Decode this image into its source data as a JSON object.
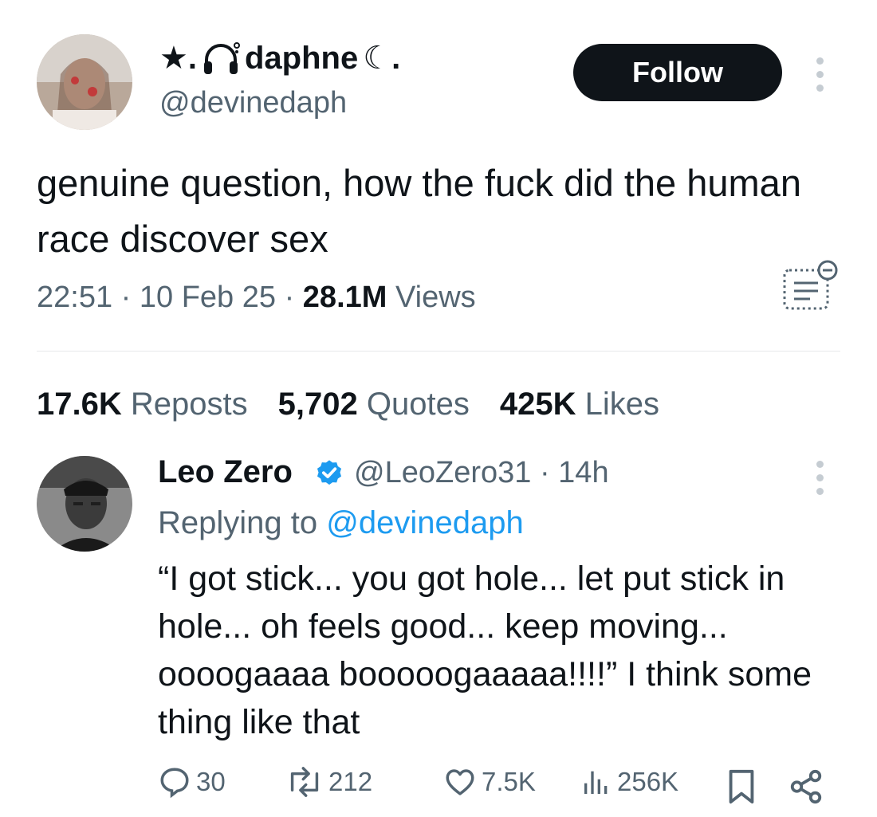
{
  "tweet": {
    "display_name_prefix": "★.",
    "display_name": "daphne",
    "display_name_suffix": "☾.",
    "handle": "@devinedaph",
    "follow_label": "Follow",
    "text": "genuine question, how the fuck did the human race discover sex",
    "time": "22:51",
    "date": "10 Feb 25",
    "views_count": "28.1M",
    "views_label": "Views",
    "stats": {
      "reposts_count": "17.6K",
      "reposts_label": "Reposts",
      "quotes_count": "5,702",
      "quotes_label": "Quotes",
      "likes_count": "425K",
      "likes_label": "Likes"
    }
  },
  "reply": {
    "display_name": "Leo Zero",
    "handle": "@LeoZero31",
    "time_ago": "14h",
    "replying_prefix": "Replying to",
    "replying_handle": "@devinedaph",
    "text": "“I got stick... you got hole... let put stick in hole... oh feels good... keep moving... oooogaaaa booooogaaaaa!!!!” I think some thing like that",
    "actions": {
      "replies": "30",
      "reposts": "212",
      "likes": "7.5K",
      "views": "256K"
    }
  },
  "colors": {
    "text_primary": "#0f1419",
    "text_secondary": "#536471",
    "link": "#1d9bf0",
    "follow_bg": "#0f1419",
    "divider": "#e6e9eb"
  },
  "icons": [
    "headphones-icon",
    "more-icon",
    "community-notes-icon",
    "verified-badge-icon",
    "reply-icon",
    "repost-icon",
    "like-icon",
    "views-icon",
    "bookmark-icon",
    "share-icon"
  ]
}
